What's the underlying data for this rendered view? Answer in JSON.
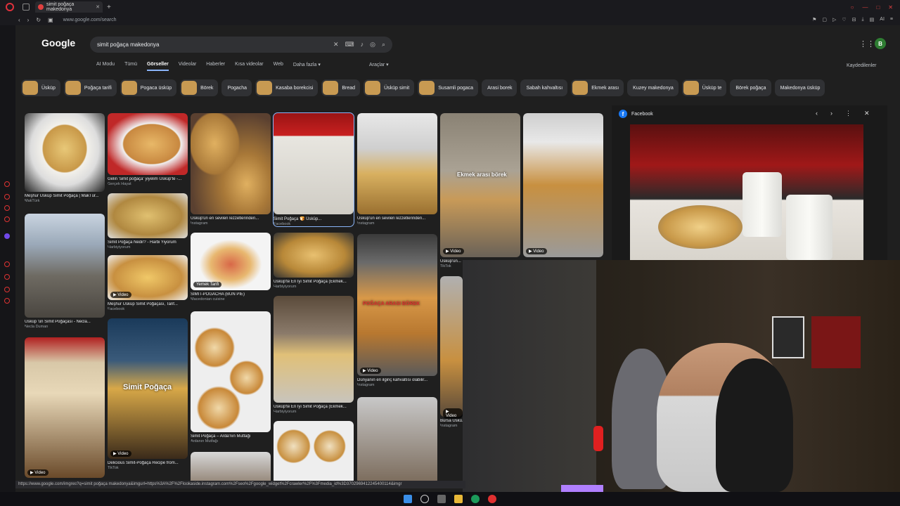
{
  "browser": {
    "tab_title": "simit poğaça makedonya",
    "url": "www.google.com/search",
    "new_tab": "+",
    "ai_label": "AI"
  },
  "google": {
    "logo": "Google",
    "query": "simit poğaça makedonya",
    "avatar_letter": "B",
    "tabs": [
      "AI Modu",
      "Tümü",
      "Görseller",
      "Videolar",
      "Haberler",
      "Kısa videolar",
      "Web",
      "Daha fazla ▾"
    ],
    "tools": "Araçlar ▾",
    "saved": "Kaydedilenler",
    "chips": [
      {
        "label": "Üsküp",
        "thumb": true
      },
      {
        "label": "Poğaça tarifi",
        "thumb": true
      },
      {
        "label": "Pogaca üsküp",
        "thumb": true
      },
      {
        "label": "Börek",
        "thumb": true
      },
      {
        "label": "Pogacha",
        "thumb": false
      },
      {
        "label": "Kasaba borekcisi",
        "thumb": true
      },
      {
        "label": "Bread",
        "thumb": true
      },
      {
        "label": "Üsküp simit",
        "thumb": true
      },
      {
        "label": "Susamli pogaca",
        "thumb": true
      },
      {
        "label": "Arasi borek",
        "thumb": false
      },
      {
        "label": "Sabah kahvaltısı",
        "thumb": false
      },
      {
        "label": "Ekmek arası",
        "thumb": true
      },
      {
        "label": "Kuzey makedonya",
        "thumb": false
      },
      {
        "label": "Üsküp te",
        "thumb": true
      },
      {
        "label": "Börek poğaça",
        "thumb": false
      },
      {
        "label": "Makedonya üsküp",
        "thumb": false
      }
    ]
  },
  "results": {
    "c1": [
      {
        "caption": "Meşhur Üsküp Simit Poğaça | MakTür...",
        "source": "MakTürk"
      },
      {
        "caption": "Üsküp 'ün Simit Poğaçası - Necla...",
        "source": "Necla Duman"
      },
      {
        "caption": "",
        "source": "",
        "badge": "▶ Video"
      }
    ],
    "c2": [
      {
        "caption": "Gelin 'simit poğaça' yiyelim Üsküp'te -...",
        "source": "Gerçek Hayat"
      },
      {
        "caption": "Simit Poğaça Nedir? - Harbi Yiyorum",
        "source": "Harbiyiyorum"
      },
      {
        "caption": "Meşhur Üsküp Simit Poğaçası, Tarif...",
        "source": "Facebook",
        "badge": "▶ Video"
      },
      {
        "caption": "Delicious Simit-Poğaça Recipe from...",
        "source": "TikTok",
        "badge": "▶ Video",
        "overlay": "Simit Poğaça"
      }
    ],
    "c3": [
      {
        "caption": "Üsküp'ün en sevilen lezzetlerinden...",
        "source": "Instagram"
      },
      {
        "caption": "SIMIT-POGACHA (BUN PIE)",
        "source": "Macedonian cuisine",
        "badge": "Yemek Tarifi"
      },
      {
        "caption": "Simit Poğaça – Arda'nın Mutfağı",
        "source": "Ardanın Mutfağı"
      }
    ],
    "c4": [
      {
        "caption": "Simit Poğaça 🍞 Üsküp...",
        "source": "Facebook"
      },
      {
        "caption": "Üsküp'te En İyi Simit Poğaça (Ekmek...",
        "source": "Harbiyiyorum"
      },
      {
        "caption": "Üsküp'te En İyi Simit Poğaça (Ekmek...",
        "source": "Harbiyiyorum"
      }
    ],
    "c5": [
      {
        "caption": "Üsküp'ün en sevilen lezzetlerinden...",
        "source": "Instagram"
      },
      {
        "caption": "Dünyanın en ilginç kahvaltısı olabilir...",
        "source": "Instagram",
        "badge": "▶ Video",
        "overlay": "POĞAÇA ARASI BÖREK"
      }
    ],
    "c6": [
      {
        "caption": "Üsküp'ün...",
        "source": "TikTok",
        "badge": "▶ Video",
        "overlay": "Ekmek arası börek"
      },
      {
        "caption": "Bursa Üskü...",
        "source": "Instagram",
        "badge": "▶ Video"
      }
    ],
    "c7": [
      {
        "caption": "",
        "source": "",
        "badge": "▶ Video"
      }
    ]
  },
  "preview": {
    "source": "Facebook",
    "prev": "‹",
    "next": "›",
    "more": "⋮",
    "close": "✕"
  },
  "status_url": "https://www.google.com/imgres?q=simit poğaça makedonya&imgurl=https%3A%2F%2Flookaside.instagram.com%2Fseo%2Fgoogle_widget%2Fcrawler%2F%3Fmedia_id%3D3702969412245400114&imgr"
}
